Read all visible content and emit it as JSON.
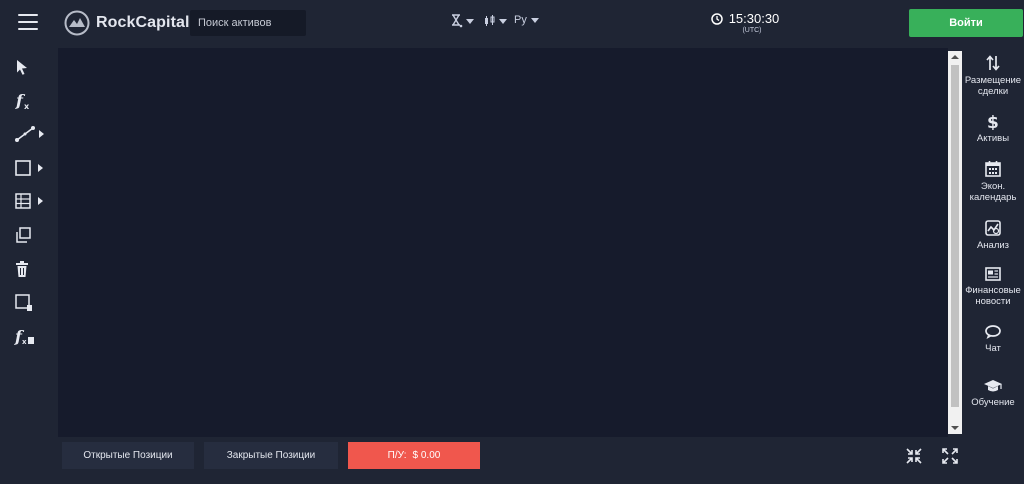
{
  "header": {
    "brand": "RockCapital",
    "search_placeholder": "Поиск активов",
    "language": "Ру",
    "time": "15:30:30",
    "timezone": "(UTC)",
    "login_label": "Войти",
    "icons": [
      "menu-icon",
      "logo-icon",
      "timeframe-icon",
      "chart-type-icon",
      "clock-icon"
    ]
  },
  "left_toolbar": {
    "tools": [
      {
        "name": "cursor-icon"
      },
      {
        "name": "function-icon"
      },
      {
        "name": "line-tool-icon",
        "submenu": true
      },
      {
        "name": "rectangle-icon",
        "submenu": true
      },
      {
        "name": "grid-icon",
        "submenu": true
      },
      {
        "name": "clone-icon"
      },
      {
        "name": "trash-icon"
      },
      {
        "name": "delete-drawing-icon"
      },
      {
        "name": "delete-indicator-icon"
      }
    ]
  },
  "right_panel": {
    "items": [
      {
        "icon": "arrows-updown-icon",
        "label": "Размещение сделки"
      },
      {
        "icon": "dollar-icon",
        "label": "Активы"
      },
      {
        "icon": "calendar-icon",
        "label": "Экон. календарь"
      },
      {
        "icon": "analysis-icon",
        "label": "Анализ"
      },
      {
        "icon": "newspaper-icon",
        "label": "Финансовые новости"
      },
      {
        "icon": "chat-icon",
        "label": "Чат"
      },
      {
        "icon": "graduation-cap-icon",
        "label": "Обучение"
      }
    ]
  },
  "bottom": {
    "open_positions": "Открытые Позиции",
    "closed_positions": "Закрытые Позиции",
    "pnl_label": "П/У:",
    "pnl_value": "$ 0.00"
  },
  "colors": {
    "background": "#1f2534",
    "chart": "#161b2c",
    "accent_green": "#38b05a",
    "pnl_red": "#f0574d"
  }
}
